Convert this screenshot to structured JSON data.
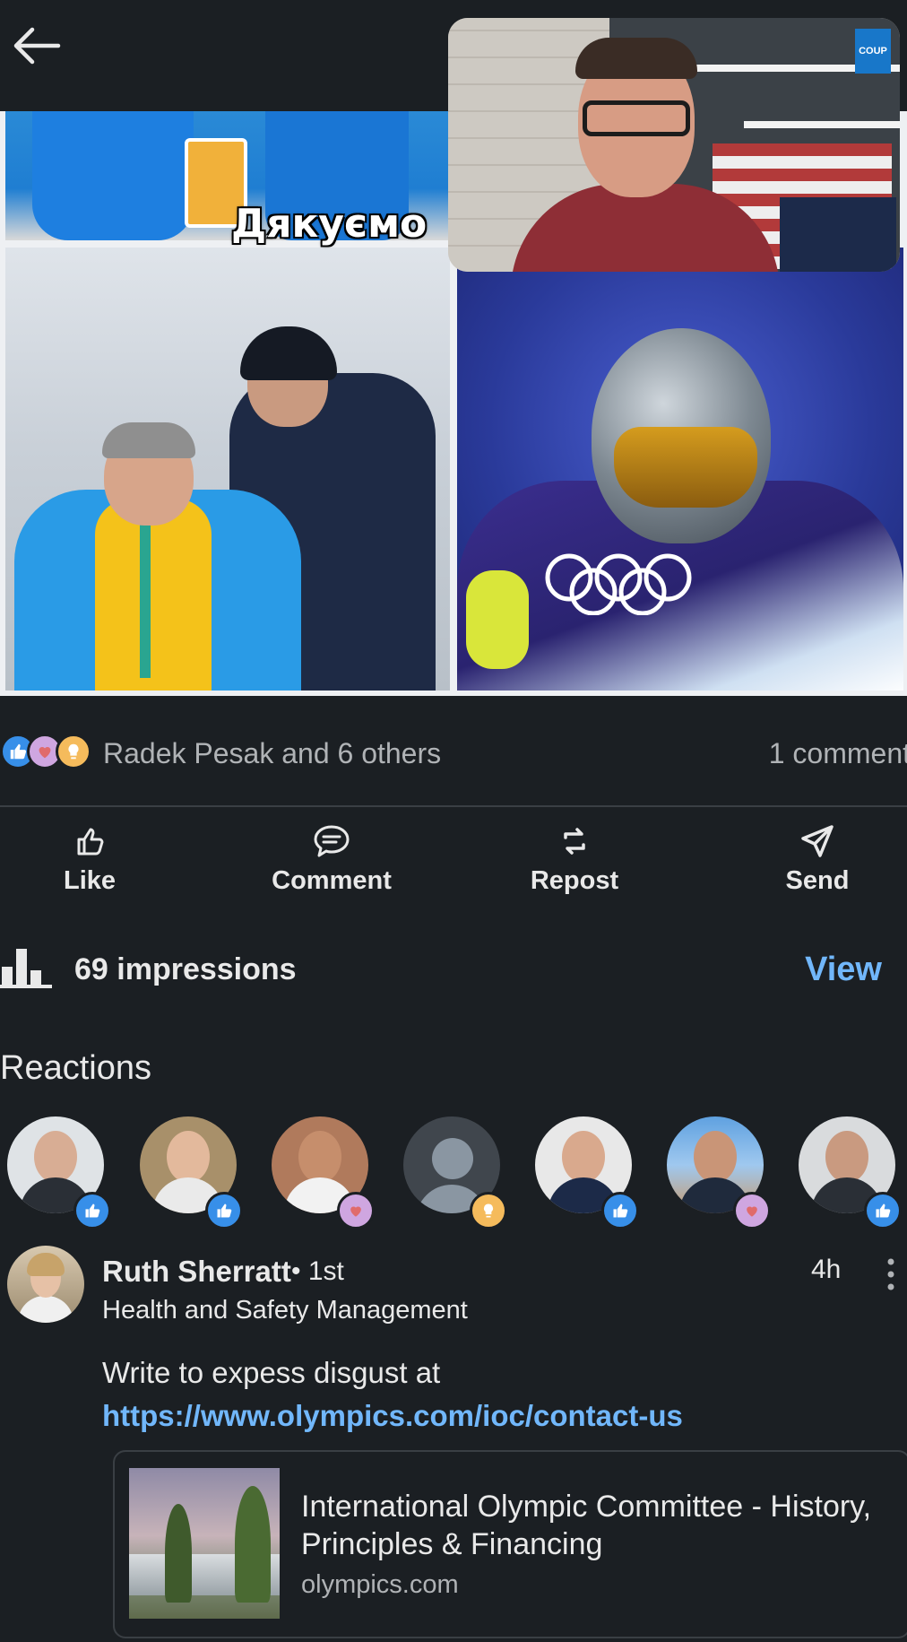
{
  "post": {
    "image_caption": "Дякуємо",
    "pip_logo_text": "COUP"
  },
  "social": {
    "reactors": "Radek Pesak and 6 others",
    "comments": "1 comment"
  },
  "actions": {
    "like": "Like",
    "comment": "Comment",
    "repost": "Repost",
    "send": "Send"
  },
  "analytics": {
    "impressions": "69 impressions",
    "view": "View"
  },
  "reactions": {
    "heading": "Reactions",
    "avatars": [
      {
        "reaction": "like"
      },
      {
        "reaction": "like"
      },
      {
        "reaction": "love"
      },
      {
        "reaction": "insightful"
      },
      {
        "reaction": "like"
      },
      {
        "reaction": "love"
      },
      {
        "reaction": "like"
      }
    ]
  },
  "comment": {
    "name": "Ruth Sherratt",
    "degree": "• 1st",
    "time": "4h",
    "headline": "Health and Safety Management",
    "text": "Write to expess disgust at",
    "link": "https://www.olympics.com/ioc/contact-us",
    "card": {
      "title": "International Olympic Committee - History, Principles & Financing",
      "domain": "olympics.com"
    }
  },
  "colors": {
    "background": "#1b1f23",
    "link": "#71b7fb",
    "like": "#378fe9",
    "love": "#cfa6e0",
    "insightful": "#f5bb5c"
  }
}
